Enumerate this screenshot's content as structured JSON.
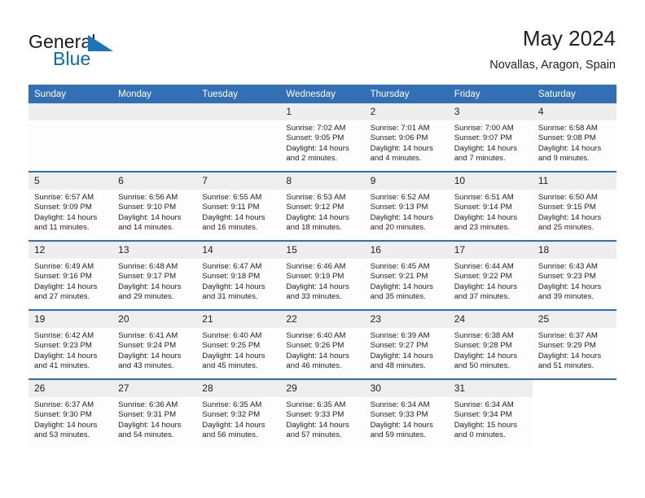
{
  "brand": {
    "word_one": "General",
    "word_two": "Blue",
    "flag_icon": "brand-triangle-icon"
  },
  "header": {
    "title": "May 2024",
    "subtitle": "Novallas, Aragon, Spain"
  },
  "colors": {
    "header_blue": "#336fb5",
    "brand_blue": "#0c68b5",
    "daynum_bg": "#eeeeee",
    "cell_bg": "#fdfdfd"
  },
  "weekdays": [
    "Sunday",
    "Monday",
    "Tuesday",
    "Wednesday",
    "Thursday",
    "Friday",
    "Saturday"
  ],
  "labels": {
    "sunrise_prefix": "Sunrise:",
    "sunset_prefix": "Sunset:",
    "daylight_prefix": "Daylight:"
  },
  "weeks": [
    [
      {
        "day": "",
        "empty": true
      },
      {
        "day": "",
        "empty": true
      },
      {
        "day": "",
        "empty": true
      },
      {
        "day": "1",
        "sunrise": "Sunrise: 7:02 AM",
        "sunset": "Sunset: 9:05 PM",
        "daylight_l1": "Daylight: 14 hours",
        "daylight_l2": "and 2 minutes."
      },
      {
        "day": "2",
        "sunrise": "Sunrise: 7:01 AM",
        "sunset": "Sunset: 9:06 PM",
        "daylight_l1": "Daylight: 14 hours",
        "daylight_l2": "and 4 minutes."
      },
      {
        "day": "3",
        "sunrise": "Sunrise: 7:00 AM",
        "sunset": "Sunset: 9:07 PM",
        "daylight_l1": "Daylight: 14 hours",
        "daylight_l2": "and 7 minutes."
      },
      {
        "day": "4",
        "sunrise": "Sunrise: 6:58 AM",
        "sunset": "Sunset: 9:08 PM",
        "daylight_l1": "Daylight: 14 hours",
        "daylight_l2": "and 9 minutes."
      }
    ],
    [
      {
        "day": "5",
        "sunrise": "Sunrise: 6:57 AM",
        "sunset": "Sunset: 9:09 PM",
        "daylight_l1": "Daylight: 14 hours",
        "daylight_l2": "and 11 minutes."
      },
      {
        "day": "6",
        "sunrise": "Sunrise: 6:56 AM",
        "sunset": "Sunset: 9:10 PM",
        "daylight_l1": "Daylight: 14 hours",
        "daylight_l2": "and 14 minutes."
      },
      {
        "day": "7",
        "sunrise": "Sunrise: 6:55 AM",
        "sunset": "Sunset: 9:11 PM",
        "daylight_l1": "Daylight: 14 hours",
        "daylight_l2": "and 16 minutes."
      },
      {
        "day": "8",
        "sunrise": "Sunrise: 6:53 AM",
        "sunset": "Sunset: 9:12 PM",
        "daylight_l1": "Daylight: 14 hours",
        "daylight_l2": "and 18 minutes."
      },
      {
        "day": "9",
        "sunrise": "Sunrise: 6:52 AM",
        "sunset": "Sunset: 9:13 PM",
        "daylight_l1": "Daylight: 14 hours",
        "daylight_l2": "and 20 minutes."
      },
      {
        "day": "10",
        "sunrise": "Sunrise: 6:51 AM",
        "sunset": "Sunset: 9:14 PM",
        "daylight_l1": "Daylight: 14 hours",
        "daylight_l2": "and 23 minutes."
      },
      {
        "day": "11",
        "sunrise": "Sunrise: 6:50 AM",
        "sunset": "Sunset: 9:15 PM",
        "daylight_l1": "Daylight: 14 hours",
        "daylight_l2": "and 25 minutes."
      }
    ],
    [
      {
        "day": "12",
        "sunrise": "Sunrise: 6:49 AM",
        "sunset": "Sunset: 9:16 PM",
        "daylight_l1": "Daylight: 14 hours",
        "daylight_l2": "and 27 minutes."
      },
      {
        "day": "13",
        "sunrise": "Sunrise: 6:48 AM",
        "sunset": "Sunset: 9:17 PM",
        "daylight_l1": "Daylight: 14 hours",
        "daylight_l2": "and 29 minutes."
      },
      {
        "day": "14",
        "sunrise": "Sunrise: 6:47 AM",
        "sunset": "Sunset: 9:18 PM",
        "daylight_l1": "Daylight: 14 hours",
        "daylight_l2": "and 31 minutes."
      },
      {
        "day": "15",
        "sunrise": "Sunrise: 6:46 AM",
        "sunset": "Sunset: 9:19 PM",
        "daylight_l1": "Daylight: 14 hours",
        "daylight_l2": "and 33 minutes."
      },
      {
        "day": "16",
        "sunrise": "Sunrise: 6:45 AM",
        "sunset": "Sunset: 9:21 PM",
        "daylight_l1": "Daylight: 14 hours",
        "daylight_l2": "and 35 minutes."
      },
      {
        "day": "17",
        "sunrise": "Sunrise: 6:44 AM",
        "sunset": "Sunset: 9:22 PM",
        "daylight_l1": "Daylight: 14 hours",
        "daylight_l2": "and 37 minutes."
      },
      {
        "day": "18",
        "sunrise": "Sunrise: 6:43 AM",
        "sunset": "Sunset: 9:23 PM",
        "daylight_l1": "Daylight: 14 hours",
        "daylight_l2": "and 39 minutes."
      }
    ],
    [
      {
        "day": "19",
        "sunrise": "Sunrise: 6:42 AM",
        "sunset": "Sunset: 9:23 PM",
        "daylight_l1": "Daylight: 14 hours",
        "daylight_l2": "and 41 minutes."
      },
      {
        "day": "20",
        "sunrise": "Sunrise: 6:41 AM",
        "sunset": "Sunset: 9:24 PM",
        "daylight_l1": "Daylight: 14 hours",
        "daylight_l2": "and 43 minutes."
      },
      {
        "day": "21",
        "sunrise": "Sunrise: 6:40 AM",
        "sunset": "Sunset: 9:25 PM",
        "daylight_l1": "Daylight: 14 hours",
        "daylight_l2": "and 45 minutes."
      },
      {
        "day": "22",
        "sunrise": "Sunrise: 6:40 AM",
        "sunset": "Sunset: 9:26 PM",
        "daylight_l1": "Daylight: 14 hours",
        "daylight_l2": "and 46 minutes."
      },
      {
        "day": "23",
        "sunrise": "Sunrise: 6:39 AM",
        "sunset": "Sunset: 9:27 PM",
        "daylight_l1": "Daylight: 14 hours",
        "daylight_l2": "and 48 minutes."
      },
      {
        "day": "24",
        "sunrise": "Sunrise: 6:38 AM",
        "sunset": "Sunset: 9:28 PM",
        "daylight_l1": "Daylight: 14 hours",
        "daylight_l2": "and 50 minutes."
      },
      {
        "day": "25",
        "sunrise": "Sunrise: 6:37 AM",
        "sunset": "Sunset: 9:29 PM",
        "daylight_l1": "Daylight: 14 hours",
        "daylight_l2": "and 51 minutes."
      }
    ],
    [
      {
        "day": "26",
        "sunrise": "Sunrise: 6:37 AM",
        "sunset": "Sunset: 9:30 PM",
        "daylight_l1": "Daylight: 14 hours",
        "daylight_l2": "and 53 minutes."
      },
      {
        "day": "27",
        "sunrise": "Sunrise: 6:36 AM",
        "sunset": "Sunset: 9:31 PM",
        "daylight_l1": "Daylight: 14 hours",
        "daylight_l2": "and 54 minutes."
      },
      {
        "day": "28",
        "sunrise": "Sunrise: 6:35 AM",
        "sunset": "Sunset: 9:32 PM",
        "daylight_l1": "Daylight: 14 hours",
        "daylight_l2": "and 56 minutes."
      },
      {
        "day": "29",
        "sunrise": "Sunrise: 6:35 AM",
        "sunset": "Sunset: 9:33 PM",
        "daylight_l1": "Daylight: 14 hours",
        "daylight_l2": "and 57 minutes."
      },
      {
        "day": "30",
        "sunrise": "Sunrise: 6:34 AM",
        "sunset": "Sunset: 9:33 PM",
        "daylight_l1": "Daylight: 14 hours",
        "daylight_l2": "and 59 minutes."
      },
      {
        "day": "31",
        "sunrise": "Sunrise: 6:34 AM",
        "sunset": "Sunset: 9:34 PM",
        "daylight_l1": "Daylight: 15 hours",
        "daylight_l2": "and 0 minutes."
      },
      {
        "day": "",
        "empty": true,
        "blank": true
      }
    ]
  ]
}
